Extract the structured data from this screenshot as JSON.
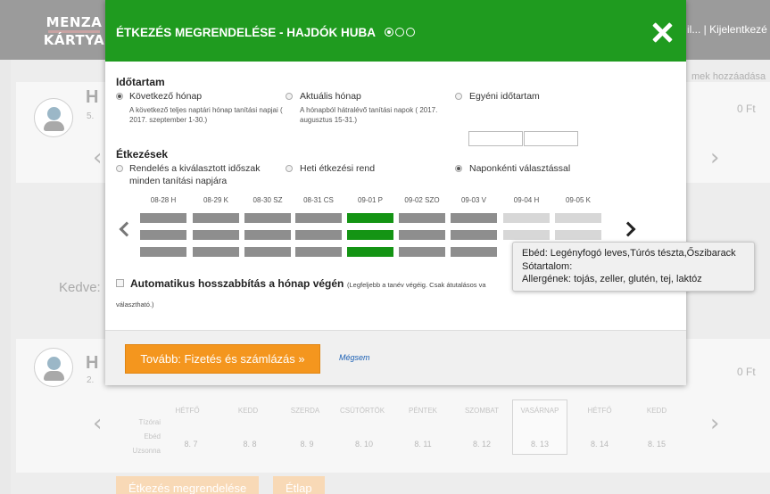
{
  "background": {
    "logo_line1": "MENZA",
    "logo_line2": "KÁRTYA",
    "header_right": "il... | Kijelentkezé",
    "add_link": "mek hozzáadása",
    "card1_initial": "H",
    "card1_sub": "5.",
    "card1_amount": "0 Ft",
    "discount_label": "Kedve:",
    "card2_initial": "H",
    "card2_sub": "2.",
    "card2_amount": "0 Ft",
    "weekdays": [
      "HÉTFŐ",
      "KEDD",
      "SZERDA",
      "CSÜTÖRTÖK",
      "PÉNTEK",
      "SZOMBAT",
      "VASÁRNAP",
      "HÉTFŐ",
      "KEDD"
    ],
    "dates": [
      "8. 7",
      "8. 8",
      "8. 9",
      "8. 10",
      "8. 11",
      "8. 12",
      "8. 13",
      "8. 14",
      "8. 15"
    ],
    "row_labels": [
      "Tízórai",
      "Ebéd",
      "Uzsonna"
    ],
    "order_button": "Étkezés megrendelése",
    "second_button": "Étlap"
  },
  "modal": {
    "title": "ÉTKEZÉS MEGRENDELÉSE - HAJDÓK HUBA",
    "steps": [
      "active",
      "inactive",
      "inactive"
    ],
    "duration": {
      "title": "Időtartam",
      "options": [
        {
          "label": "Következő hónap",
          "desc": "A következő teljes naptári hónap tanítási napjai ( 2017. szeptember 1-30.)",
          "checked": true
        },
        {
          "label": "Aktuális hónap",
          "desc": "A hónapból hátralévő tanítási napok ( 2017. augusztus 15-31.)",
          "checked": false
        },
        {
          "label": "Egyéni időtartam",
          "desc": "",
          "checked": false
        }
      ],
      "date_from": "",
      "date_to": ""
    },
    "meals": {
      "title": "Étkezések",
      "options": [
        {
          "label": "Rendelés a kiválasztott időszak",
          "label2": "minden tanítási napjára",
          "checked": false
        },
        {
          "label": "Heti étkezési rend",
          "checked": false
        },
        {
          "label": "Naponkénti választással",
          "checked": true
        }
      ]
    },
    "calendar": {
      "days": [
        "08-28 H",
        "08-29 K",
        "08-30 SZ",
        "08-31 CS",
        "09-01 P",
        "09-02 SZO",
        "09-03 V",
        "09-04 H",
        "09-05 K"
      ],
      "states": [
        "dark",
        "dark",
        "dark",
        "dark",
        "green",
        "dark",
        "dark",
        "light",
        "light"
      ]
    },
    "tooltip": {
      "line1": "Ebéd: Legényfogó leves,Túrós tészta,Őszibarack",
      "line2": "Sótartalom:",
      "line3": "Allergének: tojás, zeller, glutén, tej, laktóz"
    },
    "auto_extend": {
      "label": "Automatikus hosszabbítás a hónap végén",
      "note": "(Legfeljebb a tanév végéig. Csak átutalásos va",
      "note2": "választható.)",
      "checked": false
    },
    "next_button": "Tovább: Fizetés és számlázás »",
    "cancel_link": "Mégsem"
  }
}
